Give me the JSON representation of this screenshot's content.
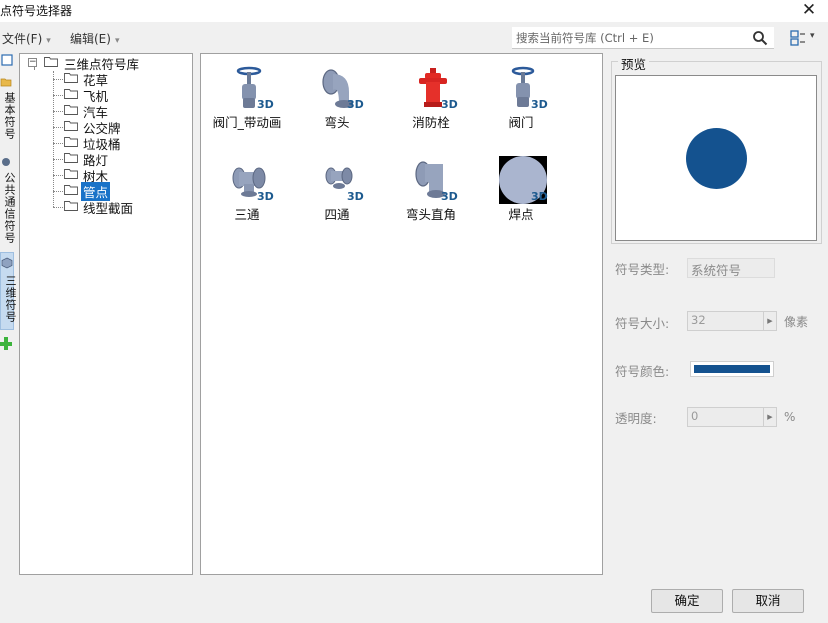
{
  "window": {
    "title": "点符号选择器",
    "close_glyph": "✕"
  },
  "menu": [
    {
      "label": "文件(F)",
      "arrow": "▾"
    },
    {
      "label": "编辑(E)",
      "arrow": "▾"
    }
  ],
  "search": {
    "placeholder": "搜索当前符号库 (Ctrl + E)",
    "icon": "search-icon"
  },
  "sidebar": {
    "tabs": [
      {
        "label": "基本符号"
      },
      {
        "label": "公共通信符号"
      },
      {
        "label": "三维符号"
      }
    ]
  },
  "tree": {
    "root": "三维点符号库",
    "expander": "−",
    "children": [
      "花草",
      "飞机",
      "汽车",
      "公交牌",
      "垃圾桶",
      "路灯",
      "树木",
      "管点",
      "线型截面"
    ],
    "selected": "管点"
  },
  "symbols": [
    {
      "label": "阀门_带动画",
      "icon": "valve-animated-icon",
      "badge": "3D"
    },
    {
      "label": "弯头",
      "icon": "elbow-icon",
      "badge": "3D"
    },
    {
      "label": "消防栓",
      "icon": "fire-hydrant-icon",
      "badge": "3D"
    },
    {
      "label": "阀门",
      "icon": "valve-icon",
      "badge": "3D"
    },
    {
      "label": "三通",
      "icon": "tee-icon",
      "badge": "3D"
    },
    {
      "label": "四通",
      "icon": "cross-icon",
      "badge": "3D"
    },
    {
      "label": "弯头直角",
      "icon": "right-angle-elbow-icon",
      "badge": "3D"
    },
    {
      "label": "焊点",
      "icon": "weld-point-icon",
      "badge": "3D"
    }
  ],
  "preview": {
    "caption": "预览",
    "color": "#14528f"
  },
  "properties": {
    "type_label": "符号类型:",
    "type_value": "系统符号",
    "size_label": "符号大小:",
    "size_value": "32",
    "size_unit": "像素",
    "color_label": "符号颜色:",
    "color_value": "#14528f",
    "opacity_label": "透明度:",
    "opacity_value": "0",
    "opacity_unit": "%"
  },
  "buttons": {
    "ok": "确定",
    "cancel": "取消"
  }
}
